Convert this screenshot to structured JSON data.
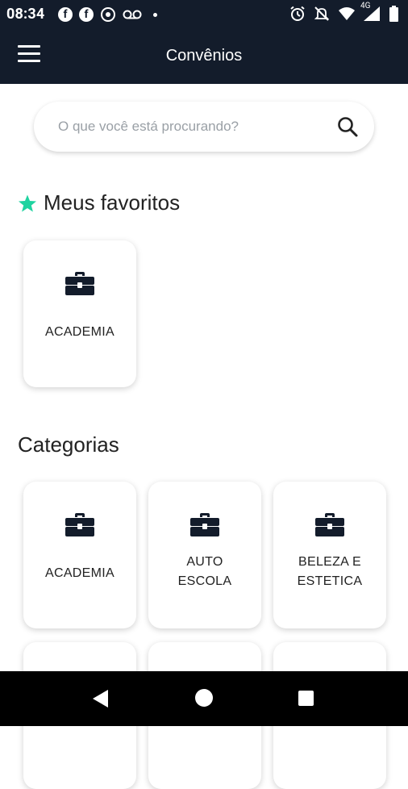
{
  "status_bar": {
    "time": "08:34",
    "network_label": "4G",
    "icons": [
      "facebook-icon",
      "facebook-icon",
      "notification-icon",
      "voicemail-icon",
      "dot-icon",
      "alarm-icon",
      "mute-icon",
      "wifi-icon",
      "signal-icon",
      "battery-icon"
    ]
  },
  "app_bar": {
    "title": "Convênios",
    "menu_icon": "hamburger-menu-icon"
  },
  "search": {
    "placeholder": "O que você está procurando?",
    "value": "",
    "icon": "search-icon"
  },
  "favorites": {
    "title": "Meus favoritos",
    "star_color": "#1fd3a0",
    "items": [
      {
        "label_lines": [
          "ACADEMIA"
        ],
        "icon": "briefcase-icon"
      }
    ]
  },
  "categories": {
    "title": "Categorias",
    "items": [
      {
        "label_lines": [
          "ACADEMIA"
        ],
        "icon": "briefcase-icon"
      },
      {
        "label_lines": [
          "AUTO",
          "ESCOLA"
        ],
        "icon": "briefcase-icon"
      },
      {
        "label_lines": [
          "BELEZA E",
          "ESTETICA"
        ],
        "icon": "briefcase-icon"
      }
    ]
  },
  "colors": {
    "header_bg": "#131c2b",
    "icon_color": "#131c2b",
    "accent": "#1fd3a0"
  },
  "nav_bar": {
    "buttons": [
      "back-icon",
      "home-icon",
      "recents-icon"
    ]
  }
}
